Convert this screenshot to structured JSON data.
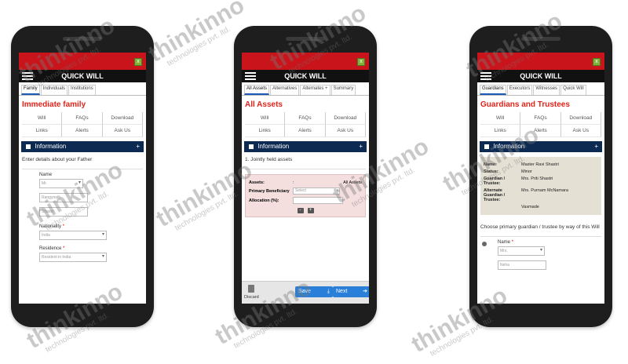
{
  "phones": [
    {
      "header_title": "QUICK WILL",
      "close_glyph": "x",
      "tabs": [
        "Family",
        "Individuals",
        "Institutions"
      ],
      "page_title": "Immediate family",
      "links": [
        "Will",
        "FAQs",
        "Download",
        "Links",
        "Alerts",
        "Ask Us"
      ],
      "info_title": "Information",
      "info_plus": "+",
      "instruction": "Enter details about your Father",
      "name_label": "Name",
      "name_title": "Mr.",
      "first_name": "Rangynath",
      "last_name": "Shastri",
      "nationality_label": "Nationality",
      "nationality_value": "India",
      "residence_label": "Residence",
      "residence_value": "Resident in India",
      "required_mark": "*"
    },
    {
      "header_title": "QUICK WILL",
      "close_glyph": "x",
      "tabs": [
        "All Assets",
        "Alternatives",
        "Alternates +",
        "Summary"
      ],
      "page_title": "All Assets",
      "links": [
        "Will",
        "FAQs",
        "Download",
        "Links",
        "Alerts",
        "Ask Us"
      ],
      "info_title": "Information",
      "info_plus": "+",
      "list_item": "1. Jointly held assets",
      "assets_label": "Assets:",
      "assets_sep": ":",
      "assets_value": "All Assets",
      "beneficiary_label": "Primary Beneficiary",
      "beneficiary_placeholder": "Select",
      "allocation_label": "Allocation (%):",
      "minus": "-",
      "plus": "+",
      "discard_label": "Discard",
      "save_label": "Save",
      "save_icon": "⤓",
      "next_label": "Next",
      "next_icon": "➔"
    },
    {
      "header_title": "QUICK WILL",
      "close_glyph": "x",
      "tabs": [
        "Guardians",
        "Executors",
        "Witnesses",
        "Quick Will"
      ],
      "page_title": "Guardians and Trustees",
      "links": [
        "Will",
        "FAQs",
        "Download",
        "Links",
        "Alerts",
        "Ask Us"
      ],
      "info_title": "Information",
      "info_plus": "+",
      "table": {
        "name_label": "Name:",
        "name_value": "Master Ravi Shastri",
        "status_label": "Status:",
        "status_value": "Minor",
        "guardian_label": "Guardian / Trustee:",
        "guardian_value": "Mrs. Priti Shastri",
        "alternate_label": "Alternate Guardian / Trustee:",
        "alternate_value": "Mrs. Purnam McNamara",
        "last_value": "Vasmade"
      },
      "choose_text": "Choose primary guardian / trustee by way of this Will",
      "name_label": "Name",
      "name_title": "Mrs.",
      "first_name": "Neha",
      "required_mark": "*"
    }
  ],
  "watermark": {
    "brand": "thinkinno",
    "sub": "technologies pvt. ltd."
  }
}
